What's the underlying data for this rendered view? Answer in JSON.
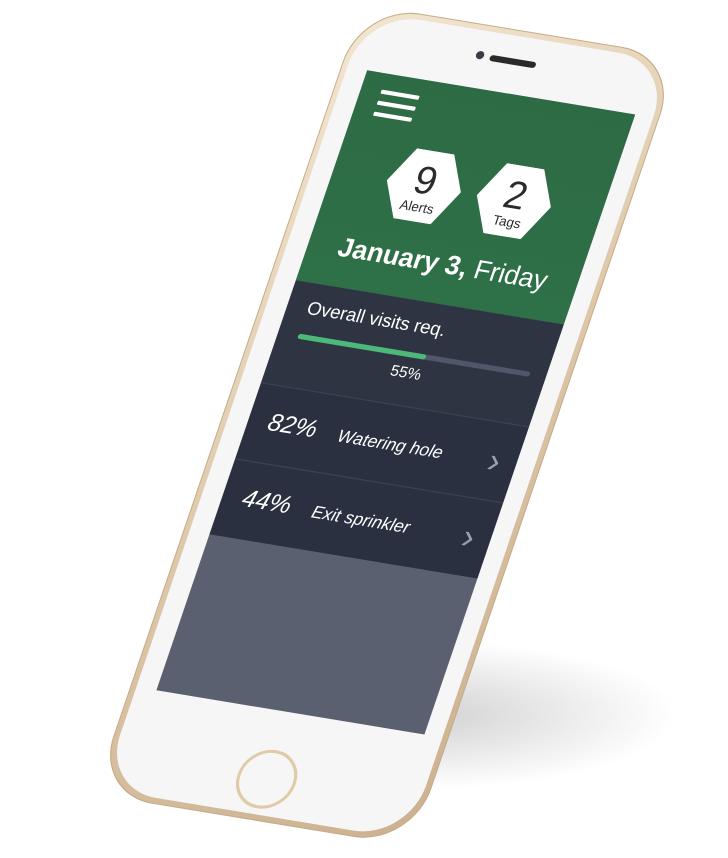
{
  "header": {
    "menu_icon": "hamburger-icon",
    "alerts": {
      "count": "9",
      "label": "Alerts"
    },
    "tags": {
      "count": "2",
      "label": "Tags"
    },
    "date_bold": "January 3,",
    "date_day": "Friday"
  },
  "visits": {
    "title": "Overall visits req.",
    "progress": 0.55,
    "progress_label": "55%"
  },
  "items": [
    {
      "percent": "82%",
      "name": "Watering hole",
      "icon": "chevron-right-icon"
    },
    {
      "percent": "44%",
      "name": "Exit sprinkler",
      "icon": "chevron-right-icon"
    }
  ],
  "colors": {
    "header_green": "#2e7048",
    "panel_dark": "#2b3040",
    "progress_green": "#4cb97a",
    "phone_gold": "#d9c2a2"
  }
}
